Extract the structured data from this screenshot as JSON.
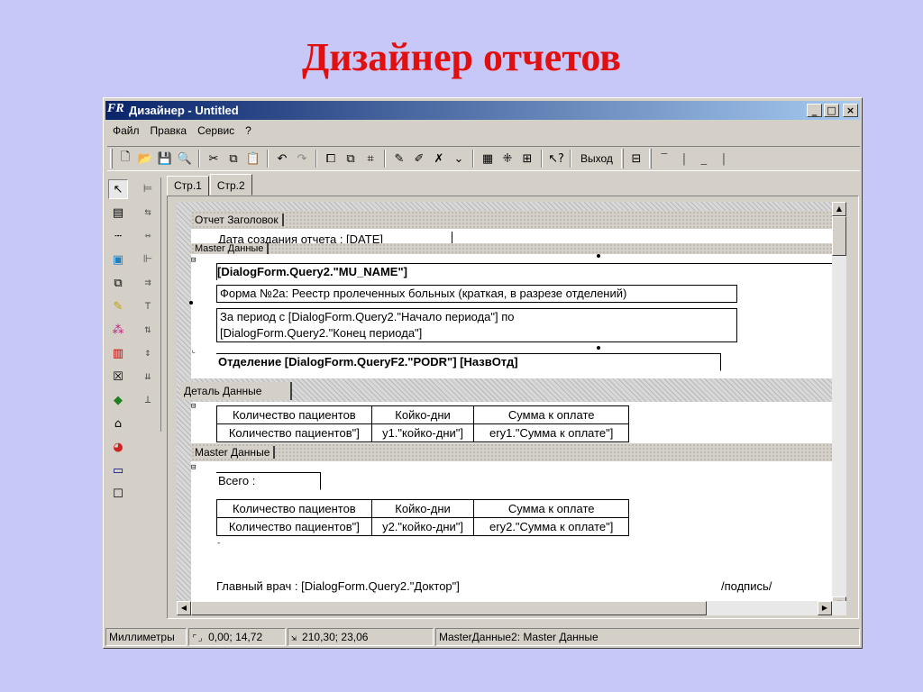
{
  "slide": {
    "title": "Дизайнер отчетов"
  },
  "window": {
    "title": "Дизайнер - Untitled",
    "controls": {
      "minimize": "_",
      "maximize": "□",
      "close": "×"
    }
  },
  "menu": [
    "Файл",
    "Правка",
    "Сервис",
    "?"
  ],
  "toolbar": {
    "exit_label": "Выход"
  },
  "tabs": [
    "Стр.1",
    "Стр.2"
  ],
  "bands": {
    "report_title": "Отчет Заголовок",
    "master1": "Master Данные",
    "detail": "Деталь Данные",
    "master2": "Master Данные"
  },
  "fields": {
    "date_created": "Дата создания отчета : [DATE]",
    "mu_name": "[DialogForm.Query2.\"MU_NAME\"]",
    "form_title": "Форма №2а: Реестр пролеченных больных (краткая, в разрезе отделений)",
    "period_line1": "За период с [DialogForm.Query2.\"Начало периода\"] по",
    "period_line2": "[DialogForm.Query2.\"Конец периода\"]",
    "department": "Отделение [DialogForm.QueryF2.\"PODR\"] [НазвОтд]",
    "total": "Всего :",
    "chief": "Главный врач : [DialogForm.Query2.\"Доктор\"]",
    "signature": "/подпись/"
  },
  "detail_table": {
    "headers": [
      "Количество пациентов",
      "Койко-дни",
      "Сумма к оплате"
    ],
    "values": [
      "Количество пациентов\"]",
      "y1.\"койко-дни\"]",
      "ery1.\"Сумма к оплате\"]"
    ]
  },
  "total_table": {
    "headers": [
      "Количество пациентов",
      "Койко-дни",
      "Сумма к оплате"
    ],
    "values": [
      "Количество пациентов\"]",
      "y2.\"койко-дни\"]",
      "ery2.\"Сумма к оплате\"]"
    ]
  },
  "status": {
    "units": "Миллиметры",
    "position": "0,00; 14,72",
    "size": "210,30; 23,06",
    "selection": "MasterДанные2: Master Данные"
  }
}
